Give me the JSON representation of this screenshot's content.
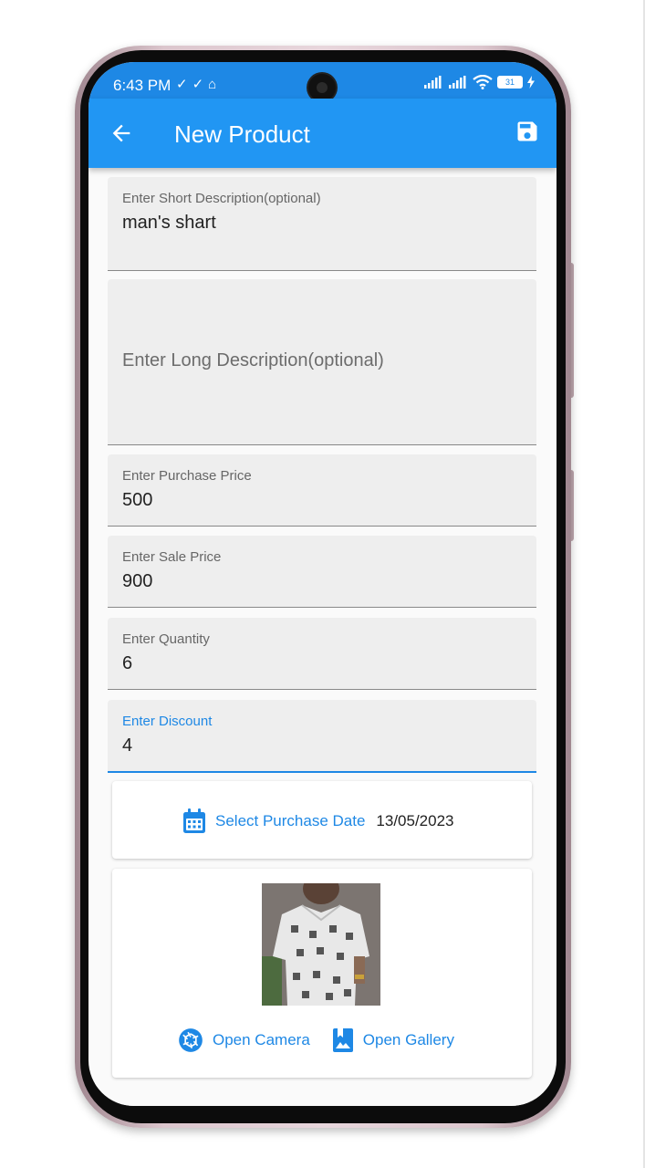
{
  "status_bar": {
    "time": "6:43 PM",
    "left_icons": [
      "check-icon",
      "check-icon",
      "notification-icon"
    ],
    "right_icons": [
      "signal-icon",
      "signal-icon",
      "wifi-icon",
      "battery-icon",
      "charging-icon"
    ],
    "battery_level": "31"
  },
  "app_bar": {
    "title": "New Product",
    "back_icon": "arrow-back-icon",
    "save_icon": "save-icon"
  },
  "form": {
    "short_description": {
      "label": "Enter Short Description(optional)",
      "value": "man's shart"
    },
    "long_description": {
      "placeholder": "Enter Long Description(optional)"
    },
    "purchase_price": {
      "label": "Enter Purchase Price",
      "value": "500"
    },
    "sale_price": {
      "label": "Enter Sale Price",
      "value": "900"
    },
    "quantity": {
      "label": "Enter Quantity",
      "value": "6"
    },
    "discount": {
      "label": "Enter Discount",
      "value": "4"
    }
  },
  "purchase_date": {
    "button_label": "Select Purchase Date",
    "value": "13/05/2023",
    "icon": "calendar-icon"
  },
  "image_picker": {
    "camera_label": "Open Camera",
    "camera_icon": "camera-icon",
    "gallery_label": "Open Gallery",
    "gallery_icon": "gallery-icon"
  },
  "colors": {
    "primary": "#2196f3",
    "status_bar": "#1e88e5",
    "accent_text": "#1e88e5",
    "field_background": "#eeeeee"
  }
}
